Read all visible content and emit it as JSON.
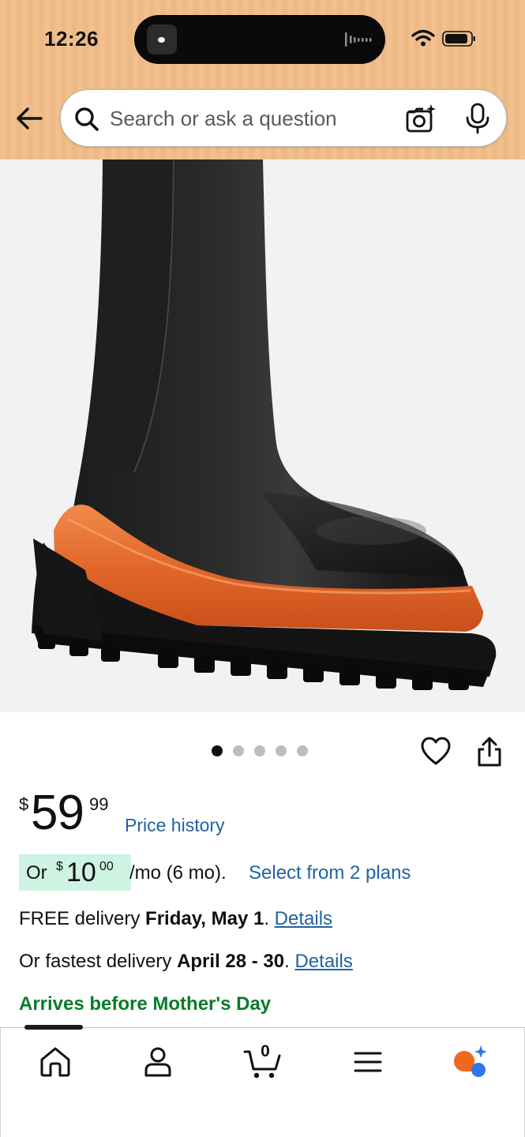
{
  "status_bar": {
    "time": "12:26"
  },
  "search": {
    "placeholder": "Search or ask a question"
  },
  "carousel": {
    "image_count": 5,
    "active_index": 0
  },
  "price": {
    "symbol": "$",
    "whole": "59",
    "fraction": "99",
    "history_label": "Price history"
  },
  "installment": {
    "prefix": "Or",
    "symbol": "$",
    "whole": "10",
    "fraction": "00",
    "term": "/mo (6 mo).",
    "link": "Select from 2 plans"
  },
  "delivery": {
    "free_prefix": "FREE delivery ",
    "free_date": "Friday, May 1",
    "free_suffix": ". ",
    "free_link": "Details",
    "fast_prefix": "Or fastest delivery ",
    "fast_date": "April 28 - 30",
    "fast_suffix": ". ",
    "fast_link": "Details",
    "arrives": "Arrives before Mother's Day"
  },
  "bottom_nav": {
    "cart_count": "0",
    "items": [
      "home-icon",
      "account-icon",
      "cart-icon",
      "menu-icon",
      "rufus-ai-icon"
    ]
  },
  "colors": {
    "header": "#f1c08e",
    "link": "#2162a1",
    "green": "#067d28",
    "installment_bg": "#cff3e3",
    "boot_sole_accent": "#e86a28"
  }
}
